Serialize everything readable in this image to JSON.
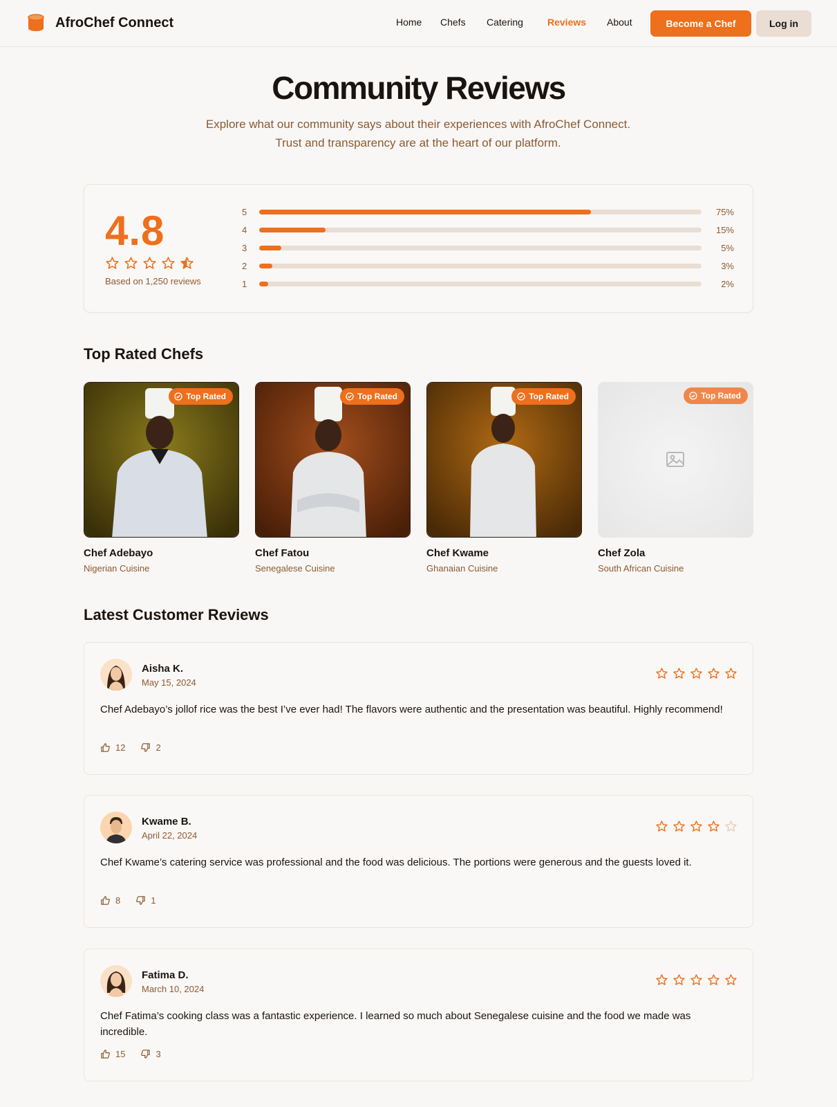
{
  "brand": {
    "name": "AfroChef Connect",
    "icon": "cylinder-logo-icon",
    "accent": "#ee6f1c"
  },
  "nav": {
    "items": [
      {
        "label": "Home",
        "active": false
      },
      {
        "label": "Chefs",
        "active": false
      },
      {
        "label": "Catering",
        "active": false
      },
      {
        "label": "Reviews",
        "active": true
      },
      {
        "label": "About",
        "active": false
      }
    ],
    "cta_primary": "Become a Chef",
    "cta_secondary": "Log in"
  },
  "hero": {
    "title": "Community Reviews",
    "subtitle_line1": "Explore what our community says about their experiences with AfroChef Connect.",
    "subtitle_line2": "Trust and transparency are at the heart of our platform."
  },
  "summary": {
    "average": "4.8",
    "stars": 4.5,
    "count_text": "Based on 1,250 reviews",
    "distribution": [
      {
        "stars": "5",
        "percent": 75,
        "label": "75%"
      },
      {
        "stars": "4",
        "percent": 15,
        "label": "15%"
      },
      {
        "stars": "3",
        "percent": 5,
        "label": "5%"
      },
      {
        "stars": "2",
        "percent": 3,
        "label": "3%"
      },
      {
        "stars": "1",
        "percent": 2,
        "label": "2%"
      }
    ]
  },
  "top_chefs": {
    "title": "Top Rated Chefs",
    "badge": "Top Rated",
    "chefs": [
      {
        "name": "Chef Adebayo",
        "cuisine": "Nigerian Cuisine"
      },
      {
        "name": "Chef Fatou",
        "cuisine": "Senegalese Cuisine"
      },
      {
        "name": "Chef Kwame",
        "cuisine": "Ghanaian Cuisine"
      },
      {
        "name": "Chef Zola",
        "cuisine": "South African Cuisine"
      }
    ]
  },
  "reviews": {
    "title": "Latest Customer Reviews",
    "items": [
      {
        "name": "Aisha K.",
        "date": "May 15, 2024",
        "rating": 5,
        "text": "Chef Adebayo’s jollof rice was the best I’ve ever had! The flavors were authentic and the presentation was beautiful. Highly recommend!",
        "likes": "12",
        "dislikes": "2"
      },
      {
        "name": "Kwame B.",
        "date": "April 22, 2024",
        "rating": 4,
        "text": "Chef Kwame’s catering service was professional and the food was delicious. The portions were generous and the guests loved it.",
        "likes": "8",
        "dislikes": "1"
      },
      {
        "name": "Fatima D.",
        "date": "March 10, 2024",
        "rating": 5,
        "text": "Chef Fatima’s cooking class was a fantastic experience. I learned so much about Senegalese cuisine and the food we made was incredible.",
        "likes": "15",
        "dislikes": "3"
      }
    ]
  }
}
